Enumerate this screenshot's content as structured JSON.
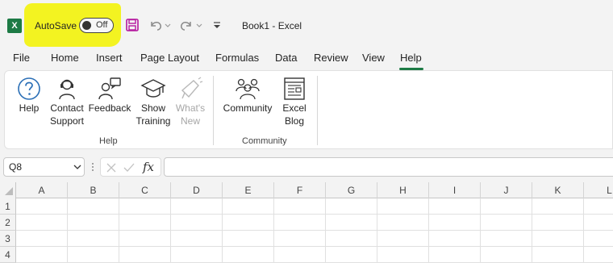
{
  "app": {
    "autosave_label": "AutoSave",
    "autosave_state": "Off",
    "doc_title": "Book1  -  Excel",
    "logo_letter": "X"
  },
  "tabs": [
    "File",
    "Home",
    "Insert",
    "Page Layout",
    "Formulas",
    "Data",
    "Review",
    "View",
    "Help"
  ],
  "active_tab": "Help",
  "ribbon": {
    "help_group": {
      "label": "Help",
      "buttons": [
        {
          "line1": "Help",
          "line2": "",
          "icon": "help-icon",
          "disabled": false
        },
        {
          "line1": "Contact",
          "line2": "Support",
          "icon": "support-agent-icon",
          "disabled": false
        },
        {
          "line1": "Feedback",
          "line2": "",
          "icon": "feedback-icon",
          "disabled": false
        },
        {
          "line1": "Show",
          "line2": "Training",
          "icon": "graduation-cap-icon",
          "disabled": false
        },
        {
          "line1": "What's",
          "line2": "New",
          "icon": "megaphone-icon",
          "disabled": true
        }
      ]
    },
    "community_group": {
      "label": "Community",
      "buttons": [
        {
          "line1": "Community",
          "line2": "",
          "icon": "people-icon",
          "disabled": false
        },
        {
          "line1": "Excel",
          "line2": "Blog",
          "icon": "blog-icon",
          "disabled": false
        }
      ]
    }
  },
  "formula_bar": {
    "name_box": "Q8",
    "fx_label": "fx",
    "formula": ""
  },
  "grid": {
    "columns": [
      "A",
      "B",
      "C",
      "D",
      "E",
      "F",
      "G",
      "H",
      "I",
      "J",
      "K",
      "L"
    ],
    "rows": [
      "1",
      "2",
      "3",
      "4"
    ]
  },
  "colors": {
    "accent": "#1d7a45",
    "highlight": "#f3f321",
    "save_icon": "#b5179e"
  }
}
